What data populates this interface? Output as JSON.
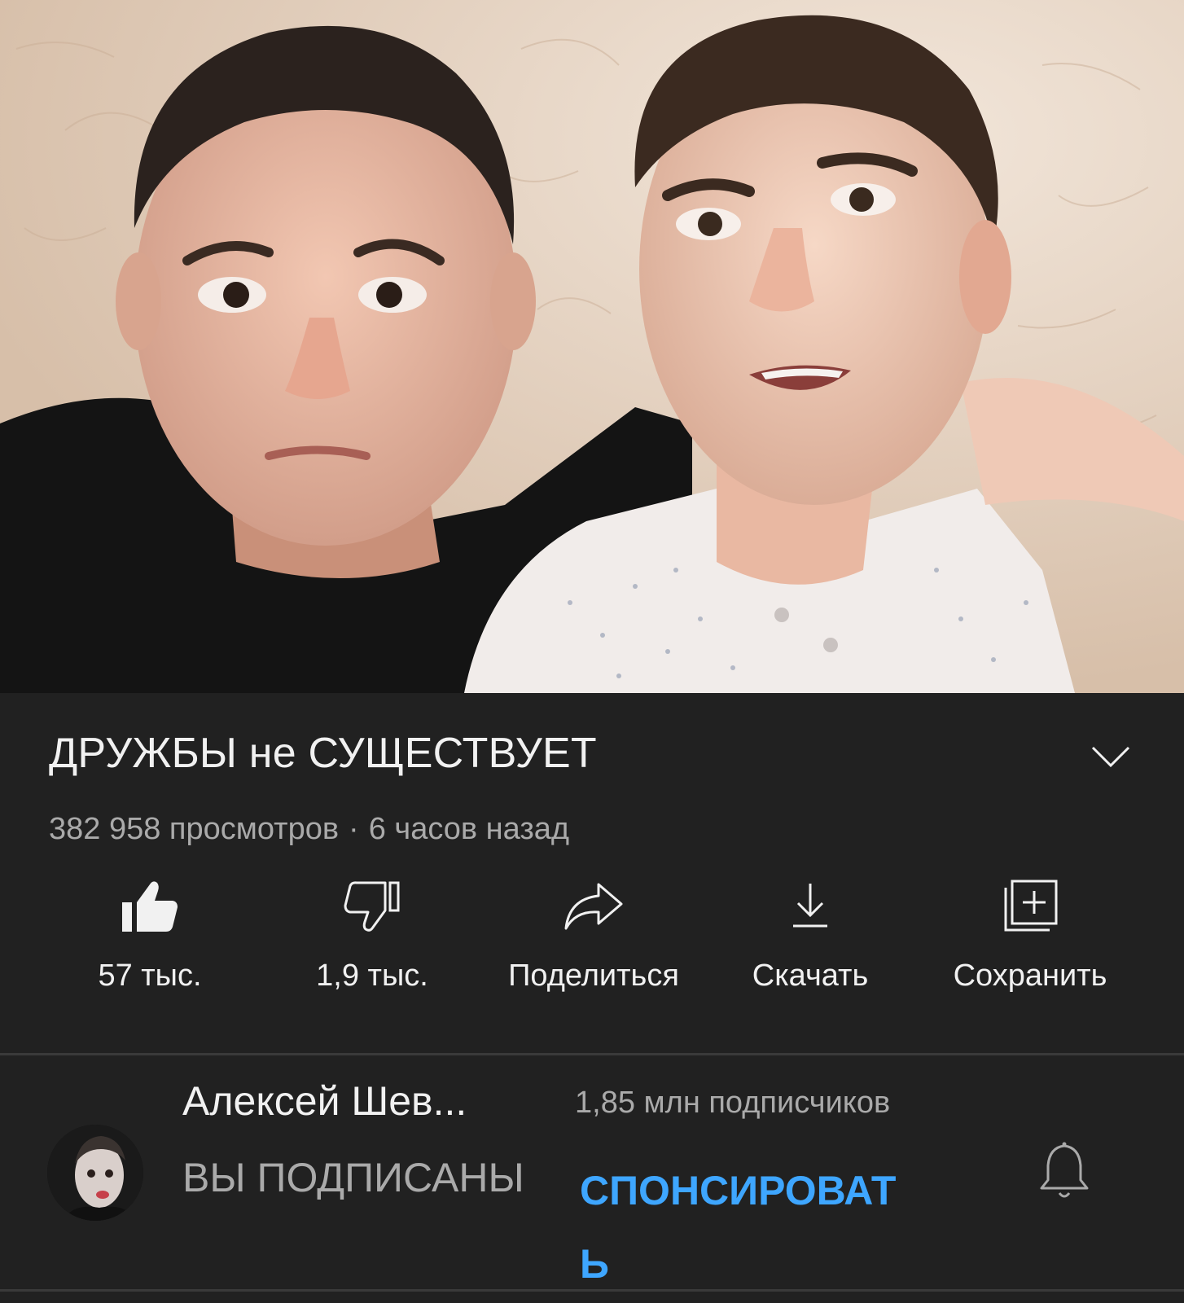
{
  "video": {
    "title": "ДРУЖБЫ не СУЩЕСТВУЕТ",
    "views": "382 958 просмотров",
    "separator": "·",
    "published": "6 часов назад"
  },
  "actions": [
    {
      "icon": "thumbs-up-icon",
      "label": "57 тыс."
    },
    {
      "icon": "thumbs-down-icon",
      "label": "1,9 тыс."
    },
    {
      "icon": "share-icon",
      "label": "Поделиться"
    },
    {
      "icon": "download-icon",
      "label": "Скачать"
    },
    {
      "icon": "add-to-playlist-icon",
      "label": "Сохранить"
    }
  ],
  "channel": {
    "name": "Алексей Шев...",
    "subscribers": "1,85 млн подписчиков",
    "subscribed_label": "ВЫ ПОДПИСАНЫ",
    "sponsor_label": "СПОНСИРОВАТЬ",
    "bell_icon": "notification-bell-icon"
  },
  "colors": {
    "background": "#212121",
    "accent": "#3ea6ff",
    "secondary_text": "#aaaaaa"
  }
}
